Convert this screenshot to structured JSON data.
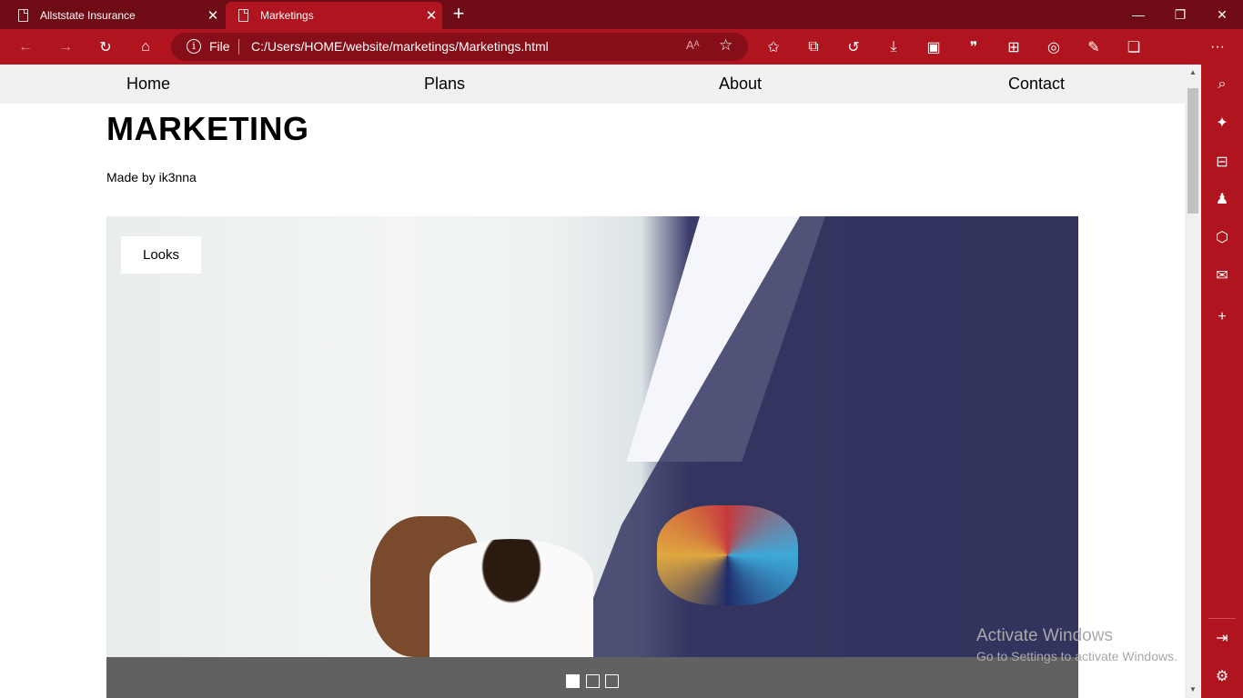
{
  "browser": {
    "tabs": [
      {
        "title": "Allststate Insurance",
        "active": false
      },
      {
        "title": "Marketings",
        "active": true
      }
    ],
    "address": {
      "scheme_label": "File",
      "url": "C:/Users/HOME/website/marketings/Marketings.html"
    },
    "colors": {
      "frame": "#6e0b14",
      "toolbar": "#b0151f",
      "address_bg": "#860e18"
    }
  },
  "nav": {
    "items": [
      "Home",
      "Plans",
      "About",
      "Contact"
    ]
  },
  "page": {
    "title": "MARKETING",
    "byline": "Made by ik3nna"
  },
  "slideshow": {
    "caption": "Looks",
    "slide_count": 3,
    "active_index": 0
  },
  "watermark": {
    "line1": "Activate Windows",
    "line2": "Go to Settings to activate Windows."
  }
}
